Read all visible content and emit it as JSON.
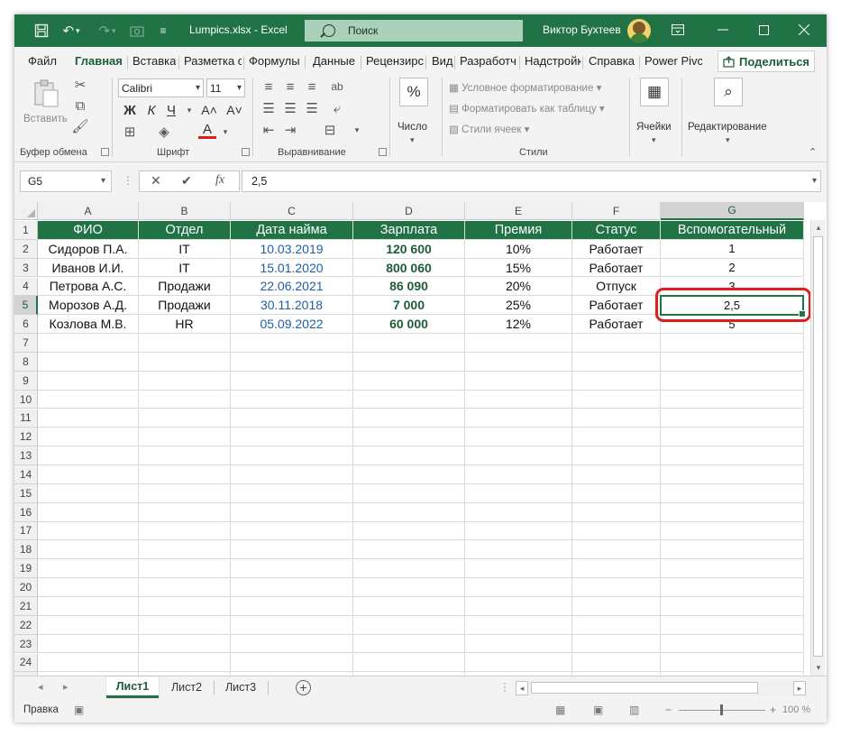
{
  "titlebar": {
    "filename": "Lumpics.xlsx  -  Excel",
    "search_label": "Поиск",
    "user_name": "Виктор Бухтеев",
    "ribbon_display_icon": "ribbon-display-icon",
    "minimize_icon": "minimize-icon",
    "maximize_icon": "maximize-icon",
    "close_icon": "close-icon"
  },
  "menu": {
    "tabs": [
      "Файл",
      "Главная",
      "Вставка",
      "Разметка с",
      "Формулы",
      "Данные",
      "Рецензирс",
      "Вид",
      "Разработч",
      "Надстройк",
      "Справка",
      "Power Pivc"
    ],
    "active": "Главная",
    "share_label": "Поделиться"
  },
  "ribbon": {
    "clipboard": {
      "paste_label": "Вставить",
      "group_label": "Буфер обмена"
    },
    "font": {
      "font_name": "Calibri",
      "font_size": "11",
      "bold": "Ж",
      "italic": "К",
      "underline": "Ч",
      "grow": "A˄",
      "shrink": "A˅",
      "font_color": "A",
      "group_label": "Шрифт",
      "font_color_hex": "#e01e1e"
    },
    "alignment": {
      "group_label": "Выравнивание"
    },
    "number": {
      "label": "Число",
      "symbol": "%"
    },
    "styles": {
      "conditional": "Условное форматирование",
      "format_table": "Форматировать как таблицу",
      "cell_styles": "Стили ячеек",
      "group_label": "Стили"
    },
    "cells_label": "Ячейки",
    "editing_label": "Редактирование"
  },
  "formula_bar": {
    "name_box": "G5",
    "cancel": "✕",
    "enter": "✔",
    "fx": "fx",
    "value": "2,5"
  },
  "sheet": {
    "columns": [
      "A",
      "B",
      "C",
      "D",
      "E",
      "F",
      "G"
    ],
    "selected_column": "G",
    "selected_row": 5,
    "header_row": [
      "ФИО",
      "Отдел",
      "Дата найма",
      "Зарплата",
      "Премия",
      "Статус",
      "Вспомогательный"
    ],
    "rows": [
      [
        "Сидоров П.А.",
        "IT",
        "10.03.2019",
        "120 600",
        "10%",
        "Работает",
        "1"
      ],
      [
        "Иванов И.И.",
        "IT",
        "15.01.2020",
        "800 060",
        "15%",
        "Работает",
        "2"
      ],
      [
        "Петрова А.С.",
        "Продажи",
        "22.06.2021",
        "86 090",
        "20%",
        "Отпуск",
        "3"
      ],
      [
        "Морозов А.Д.",
        "Продажи",
        "30.11.2018",
        "7 000",
        "25%",
        "Работает",
        "2,5"
      ],
      [
        "Козлова М.В.",
        "HR",
        "05.09.2022",
        "60 000",
        "12%",
        "Работает",
        "5"
      ]
    ],
    "row_count": 25,
    "header_color": "#217346",
    "date_color": "#1f5fa6",
    "highlight_color": "#e01e1e"
  },
  "sheet_tabs": {
    "tabs": [
      "Лист1",
      "Лист2",
      "Лист3"
    ],
    "active": "Лист1",
    "add_icon": "plus-circle-icon"
  },
  "status": {
    "text": "Правка",
    "zoom": "100 %",
    "zoom_out": "−",
    "zoom_in": "+"
  }
}
